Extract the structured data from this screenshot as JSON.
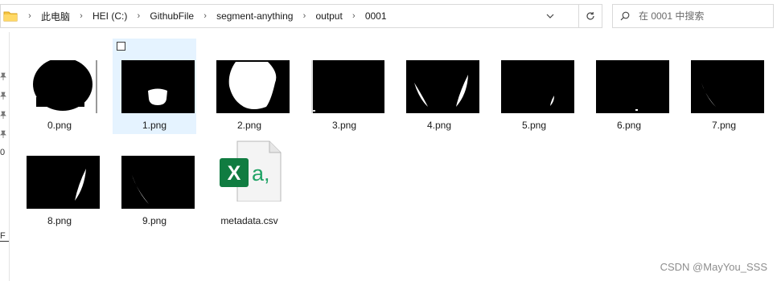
{
  "address_bar": {
    "breadcrumbs": [
      "此电脑",
      "HEI (C:)",
      "GithubFile",
      "segment-anything",
      "output",
      "0001"
    ]
  },
  "search": {
    "placeholder": "在 0001 中搜索"
  },
  "nav": {
    "fragments": [
      "0",
      "F"
    ]
  },
  "files": [
    {
      "name": "0.png",
      "kind": "image"
    },
    {
      "name": "1.png",
      "kind": "image",
      "selected": true
    },
    {
      "name": "2.png",
      "kind": "image"
    },
    {
      "name": "3.png",
      "kind": "image"
    },
    {
      "name": "4.png",
      "kind": "image"
    },
    {
      "name": "5.png",
      "kind": "image"
    },
    {
      "name": "6.png",
      "kind": "image"
    },
    {
      "name": "7.png",
      "kind": "image"
    },
    {
      "name": "8.png",
      "kind": "image"
    },
    {
      "name": "9.png",
      "kind": "image"
    },
    {
      "name": "metadata.csv",
      "kind": "csv",
      "icon": "excel-csv-icon",
      "icon_letter": "X",
      "icon_suffix": "a,"
    }
  ],
  "watermark": "CSDN @MayYou_SSS",
  "colors": {
    "selection": "#e5f3ff",
    "excel_green": "#107c41",
    "csv_teal": "#21a366"
  }
}
